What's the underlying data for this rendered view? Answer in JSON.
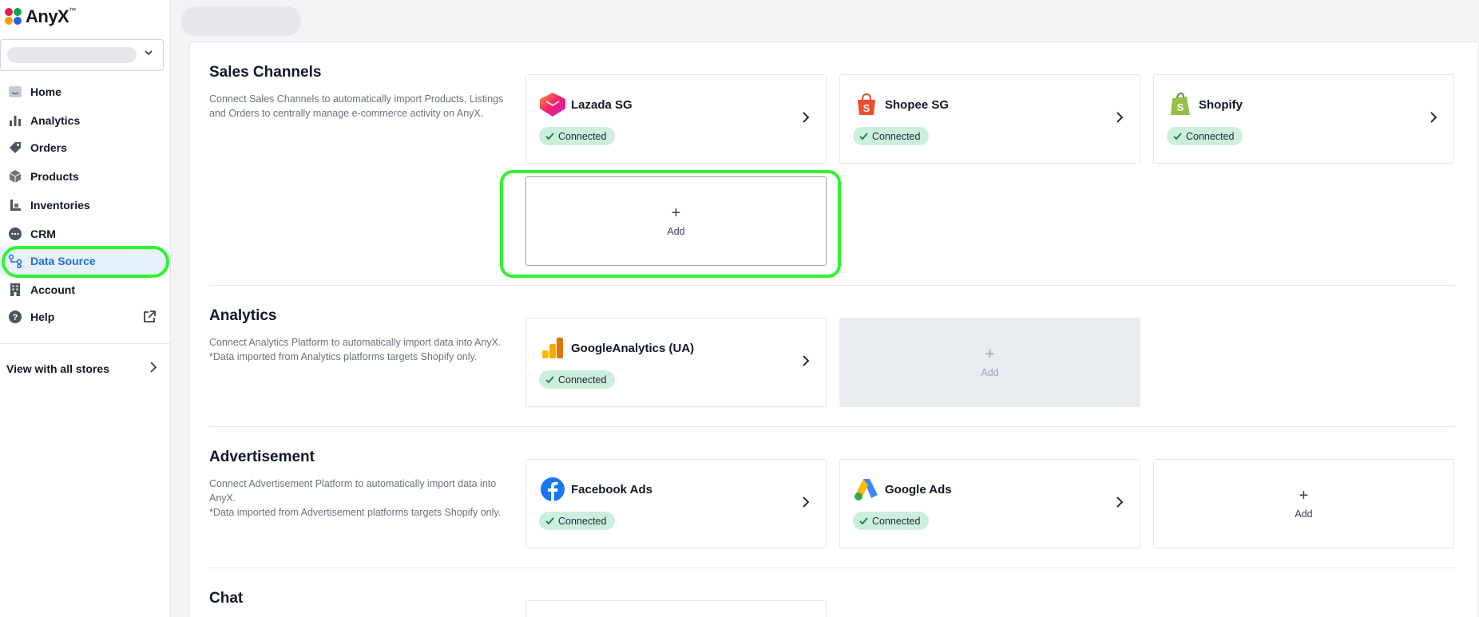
{
  "app": {
    "name": "AnyX",
    "trademark": "™"
  },
  "sidebar": {
    "items": [
      {
        "key": "home",
        "label": "Home",
        "icon": "home-icon"
      },
      {
        "key": "analytics",
        "label": "Analytics",
        "icon": "bar-chart-icon"
      },
      {
        "key": "orders",
        "label": "Orders",
        "icon": "tag-icon"
      },
      {
        "key": "products",
        "label": "Products",
        "icon": "box-icon"
      },
      {
        "key": "inventories",
        "label": "Inventories",
        "icon": "inventory-icon"
      },
      {
        "key": "crm",
        "label": "CRM",
        "icon": "chat-bubble-icon"
      },
      {
        "key": "data-source",
        "label": "Data Source",
        "icon": "data-source-icon",
        "active": true
      },
      {
        "key": "account",
        "label": "Account",
        "icon": "building-icon"
      },
      {
        "key": "help",
        "label": "Help",
        "icon": "question-icon"
      }
    ],
    "view_all_label": "View with all stores"
  },
  "sections": {
    "sales": {
      "title": "Sales Channels",
      "description": "Connect Sales Channels to automatically import Products, Listings and Orders to centrally manage e-commerce activity on AnyX.",
      "cards": [
        {
          "name": "Lazada SG",
          "status": "Connected",
          "icon": "lazada-logo-icon"
        },
        {
          "name": "Shopee SG",
          "status": "Connected",
          "icon": "shopee-logo-icon"
        },
        {
          "name": "Shopify",
          "status": "Connected",
          "icon": "shopify-logo-icon"
        }
      ],
      "add_label": "Add"
    },
    "analytics": {
      "title": "Analytics",
      "description": "Connect Analytics Platform to automatically import data into AnyX.",
      "note": "*Data imported from Analytics platforms targets Shopify only.",
      "cards": [
        {
          "name": "GoogleAnalytics (UA)",
          "status": "Connected",
          "icon": "google-analytics-logo-icon"
        }
      ],
      "add_label": "Add"
    },
    "ads": {
      "title": "Advertisement",
      "description": "Connect Advertisement Platform to automatically import data into AnyX.",
      "note": "*Data imported from Advertisement platforms targets Shopify only.",
      "cards": [
        {
          "name": "Facebook Ads",
          "status": "Connected",
          "icon": "facebook-logo-icon"
        },
        {
          "name": "Google Ads",
          "status": "Connected",
          "icon": "google-ads-logo-icon"
        }
      ],
      "add_label": "Add"
    },
    "chat": {
      "title": "Chat"
    }
  },
  "colors": {
    "accent": "#1d6fd1",
    "connected_bg": "#cdeedd",
    "connected_check": "#15803d",
    "highlight": "#2ef52e"
  },
  "plus_glyph": "+"
}
